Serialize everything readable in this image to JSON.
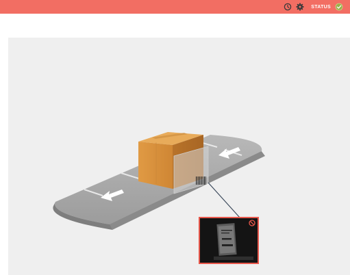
{
  "header": {
    "history_icon": "history-icon",
    "settings_icon": "gear-icon",
    "status_label": "STATUS",
    "status_icon": "check-circle-icon"
  },
  "scene": {
    "illustration": "conveyor-with-box-and-barcode-scanner",
    "preview_alert_icon": "no-entry-icon"
  },
  "colors": {
    "header_bg": "#f26e63",
    "canvas_bg": "#efefef",
    "status_ok": "#9ab04a",
    "preview_border": "#e8574b"
  }
}
